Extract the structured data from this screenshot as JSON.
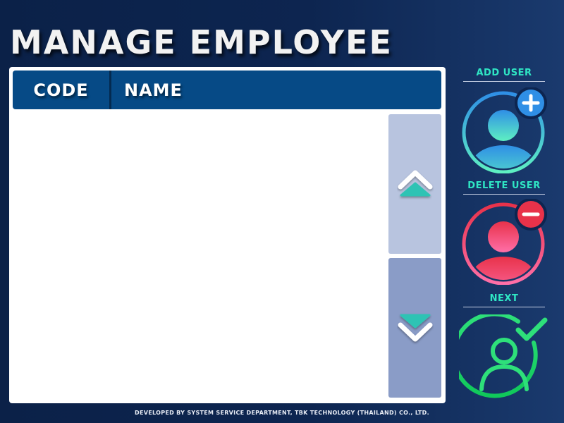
{
  "page": {
    "title": "Manage Employee"
  },
  "table": {
    "columns": [
      "CODE",
      "NAME"
    ],
    "rows": []
  },
  "scroll": {
    "up_icon": "chevron-up-icon",
    "down_icon": "chevron-down-icon"
  },
  "actions": {
    "add_user": {
      "label": "ADD USER",
      "icon": "add-user-icon"
    },
    "delete_user": {
      "label": "DELETE USER",
      "icon": "delete-user-icon"
    },
    "next": {
      "label": "NEXT",
      "icon": "user-check-icon"
    }
  },
  "footer": {
    "text": "DEVELOPED BY SYSTEM SERVICE DEPARTMENT, TBK TECHNOLOGY (THAILAND) CO., LTD."
  },
  "colors": {
    "background": "#0d2550",
    "header": "#064a86",
    "accent_label": "#2fe6c4",
    "add_gradient": [
      "#2f8fe6",
      "#5ef0c2"
    ],
    "delete_gradient": [
      "#e8324a",
      "#ff6fa8"
    ],
    "next_gradient": [
      "#2ee07a",
      "#10c85a"
    ],
    "scroll_up_bg": "#b8c4df",
    "scroll_down_bg": "#8a9cc7"
  }
}
